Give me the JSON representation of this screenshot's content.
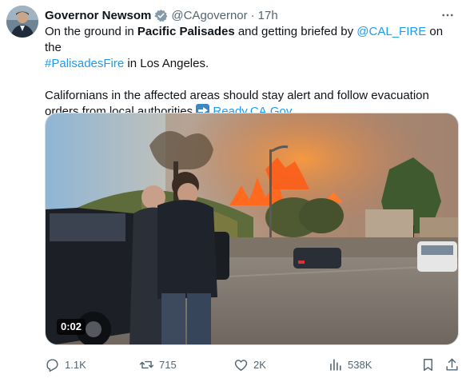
{
  "author": {
    "name": "Governor Newsom",
    "handle": "@CAgovernor",
    "separator": "·",
    "time": "17h"
  },
  "tweet": {
    "line1_pre": "On the ground in ",
    "line1_bold": "Pacific Palisades",
    "line1_mid": " and getting briefed by ",
    "mention": "@CAL_FIRE",
    "line1_post": " on the",
    "hashtag": "#PalisadesFire",
    "line2_post": " in Los Angeles.",
    "para2": "Californians in the affected areas should stay alert and follow evacuation orders from local authorities ",
    "link": "Ready.CA.Gov"
  },
  "media": {
    "duration": "0:02"
  },
  "actions": {
    "replies": "1.1K",
    "reposts": "715",
    "likes": "2K",
    "views": "538K"
  },
  "colors": {
    "link": "#1d9bf0",
    "muted": "#536471",
    "verified_badge": "#829aab"
  },
  "icons": [
    "verified-badge-icon",
    "more-icon",
    "reply-icon",
    "repost-icon",
    "like-icon",
    "views-icon",
    "bookmark-icon",
    "share-icon",
    "arrow-right-emoji"
  ]
}
